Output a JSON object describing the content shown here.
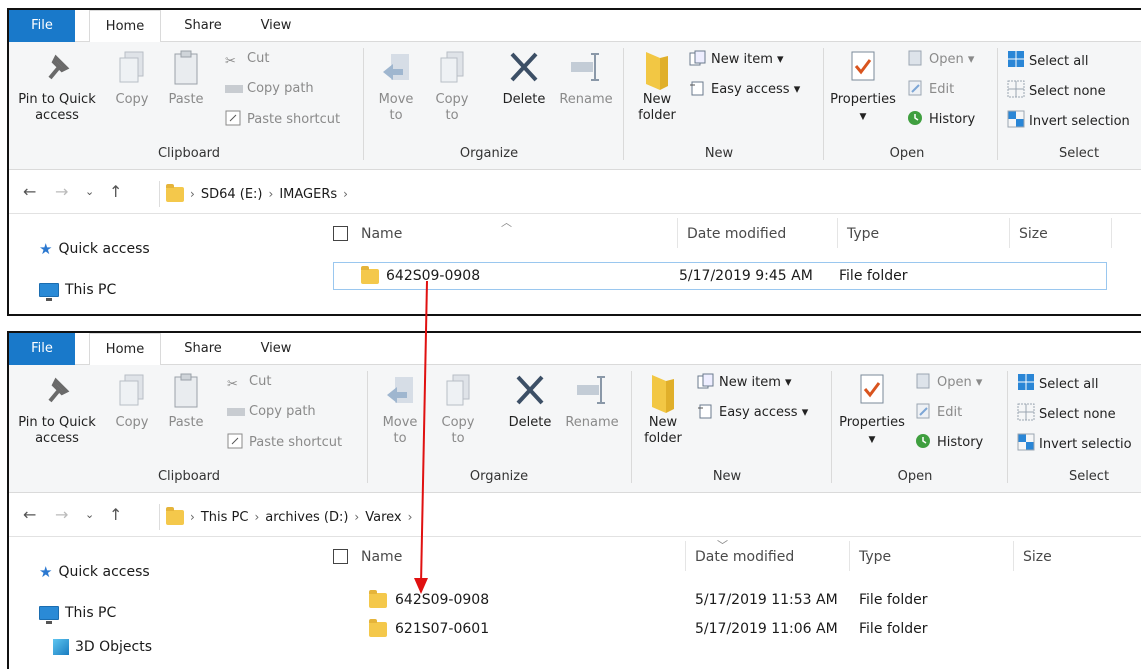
{
  "top": {
    "tabs": {
      "file": "File",
      "home": "Home",
      "share": "Share",
      "view": "View"
    },
    "clipboard": {
      "pin": "Pin to Quick access",
      "copy": "Copy",
      "paste": "Paste",
      "cut": "Cut",
      "copy_path": "Copy path",
      "paste_shortcut": "Paste shortcut",
      "label": "Clipboard"
    },
    "organize": {
      "move": "Move to",
      "copy": "Copy to",
      "delete": "Delete",
      "rename": "Rename",
      "label": "Organize"
    },
    "new": {
      "new_folder": "New folder",
      "new_item": "New item ▾",
      "easy_access": "Easy access ▾",
      "label": "New"
    },
    "open": {
      "properties": "Properties",
      "open": "Open ▾",
      "edit": "Edit",
      "history": "History",
      "label": "Open"
    },
    "select": {
      "select_all": "Select all",
      "select_none": "Select none",
      "invert": "Invert selection",
      "label": "Select"
    },
    "breadcrumb": [
      "SD64 (E:)",
      "IMAGERs"
    ],
    "nav": {
      "quick_access": "Quick access",
      "this_pc": "This PC"
    },
    "columns": {
      "name": "Name",
      "date": "Date modified",
      "type": "Type",
      "size": "Size"
    },
    "rows": [
      {
        "name": "642S09-0908",
        "date": "5/17/2019 9:45 AM",
        "type": "File folder"
      }
    ]
  },
  "bottom": {
    "tabs": {
      "file": "File",
      "home": "Home",
      "share": "Share",
      "view": "View"
    },
    "clipboard": {
      "pin": "Pin to Quick access",
      "copy": "Copy",
      "paste": "Paste",
      "cut": "Cut",
      "copy_path": "Copy path",
      "paste_shortcut": "Paste shortcut",
      "label": "Clipboard"
    },
    "organize": {
      "move": "Move to",
      "copy": "Copy to",
      "delete": "Delete",
      "rename": "Rename",
      "label": "Organize"
    },
    "new": {
      "new_folder": "New folder",
      "new_item": "New item ▾",
      "easy_access": "Easy access ▾",
      "label": "New"
    },
    "open": {
      "properties": "Properties",
      "open": "Open ▾",
      "edit": "Edit",
      "history": "History",
      "label": "Open"
    },
    "select": {
      "select_all": "Select all",
      "select_none": "Select none",
      "invert": "Invert selectio",
      "label": "Select"
    },
    "breadcrumb": [
      "This PC",
      "archives (D:)",
      "Varex"
    ],
    "nav": {
      "quick_access": "Quick access",
      "this_pc": "This PC",
      "objects": "3D Objects"
    },
    "columns": {
      "name": "Name",
      "date": "Date modified",
      "type": "Type",
      "size": "Size"
    },
    "rows": [
      {
        "name": "642S09-0908",
        "date": "5/17/2019 11:53 AM",
        "type": "File folder"
      },
      {
        "name": "621S07-0601",
        "date": "5/17/2019 11:06 AM",
        "type": "File folder"
      }
    ]
  },
  "colors": {
    "file_tab": "#1979ca",
    "arrow": "#e01010",
    "folder": "#f4c84b",
    "selection": "#9ac7ef"
  }
}
